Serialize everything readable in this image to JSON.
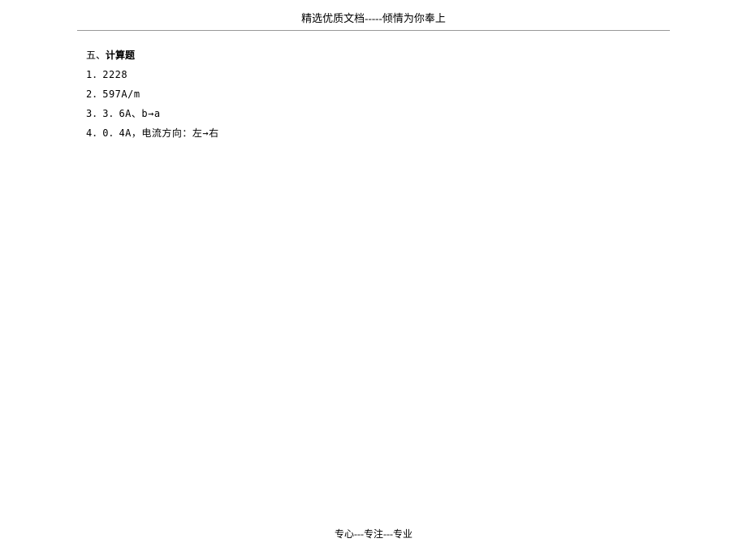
{
  "header": {
    "text": "精选优质文档-----倾情为你奉上"
  },
  "section": {
    "prefix": "五、",
    "title": "计算题"
  },
  "items": [
    "1．2228",
    "2．597A/m",
    "3．3．6A、b→a",
    "4．0．4A，电流方向：左→右"
  ],
  "footer": {
    "text": "专心---专注---专业"
  }
}
